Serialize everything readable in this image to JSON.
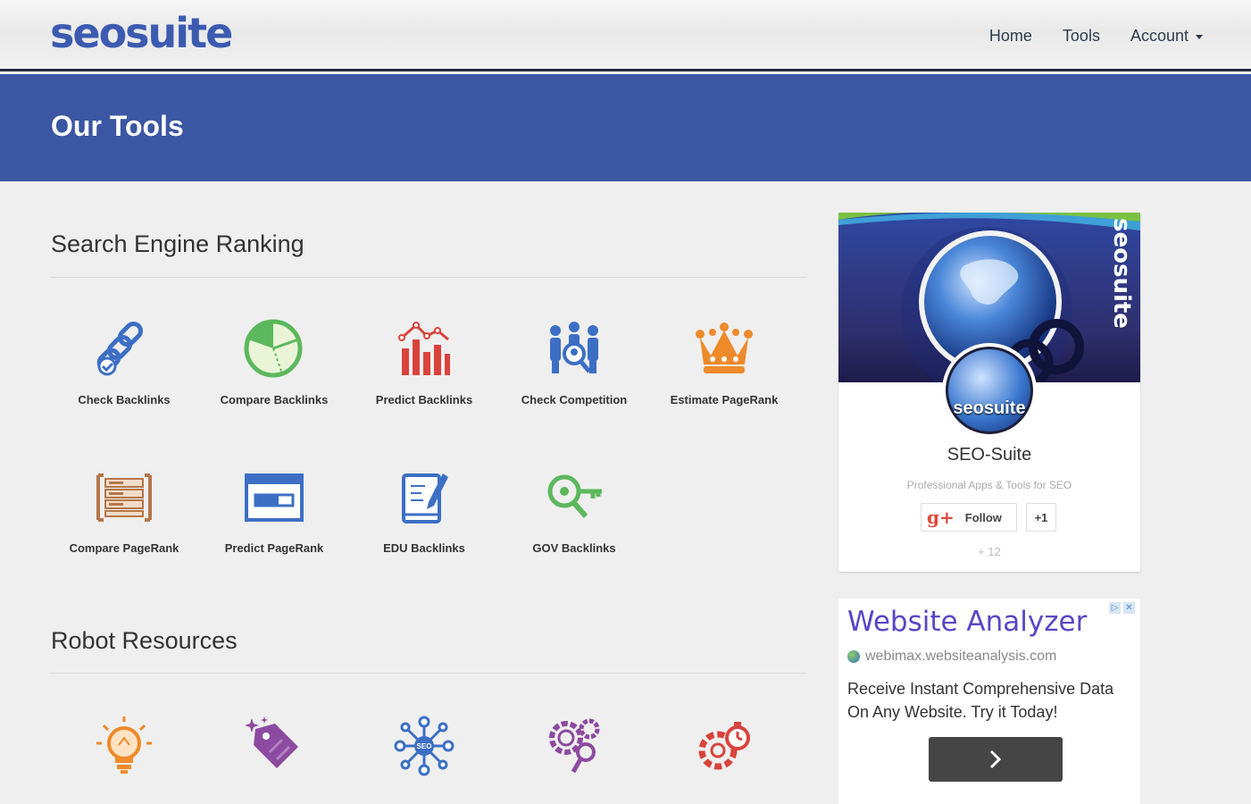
{
  "header": {
    "logo": "seosuite",
    "nav": {
      "home": "Home",
      "tools": "Tools",
      "account": "Account"
    }
  },
  "banner": {
    "title": "Our Tools"
  },
  "sections": {
    "ranking": {
      "title": "Search Engine Ranking",
      "tools": [
        "Check Backlinks",
        "Compare Backlinks",
        "Predict Backlinks",
        "Check Competition",
        "Estimate PageRank",
        "Compare PageRank",
        "Predict PageRank",
        "EDU Backlinks",
        "GOV Backlinks"
      ]
    },
    "robot": {
      "title": "Robot Resources"
    }
  },
  "gplus": {
    "banner_brand": "seosuite",
    "avatar_text": "seosuite",
    "name": "SEO-Suite",
    "tagline": "Professional Apps & Tools for SEO",
    "follow_label": "Follow",
    "plus_one_label": "+1",
    "count": "+ 12"
  },
  "ad": {
    "title": "Website Analyzer",
    "url": "webimax.websiteanalysis.com",
    "description": "Receive Instant Comprehensive Data On Any Website. Try it Today!"
  },
  "colors": {
    "brand": "#3b56a3",
    "blue": "#3c6fc4",
    "green": "#5cb85c",
    "red": "#d9433b",
    "orange": "#ee8a2a",
    "purple": "#8c4aa0",
    "brown": "#b5764a"
  }
}
